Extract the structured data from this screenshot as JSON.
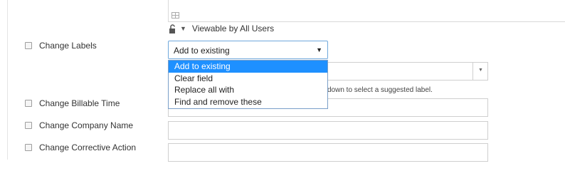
{
  "viewable": {
    "text": "Viewable by All Users"
  },
  "fields": [
    {
      "label": "Change Labels"
    },
    {
      "label": "Change Billable Time"
    },
    {
      "label": "Change Company Name"
    },
    {
      "label": "Change Corrective Action"
    }
  ],
  "labels_mode": {
    "selected": "Add to existing",
    "options": [
      "Add to existing",
      "Clear field",
      "Replace all with",
      "Find and remove these"
    ]
  },
  "label_hint": "down to select a suggested label."
}
